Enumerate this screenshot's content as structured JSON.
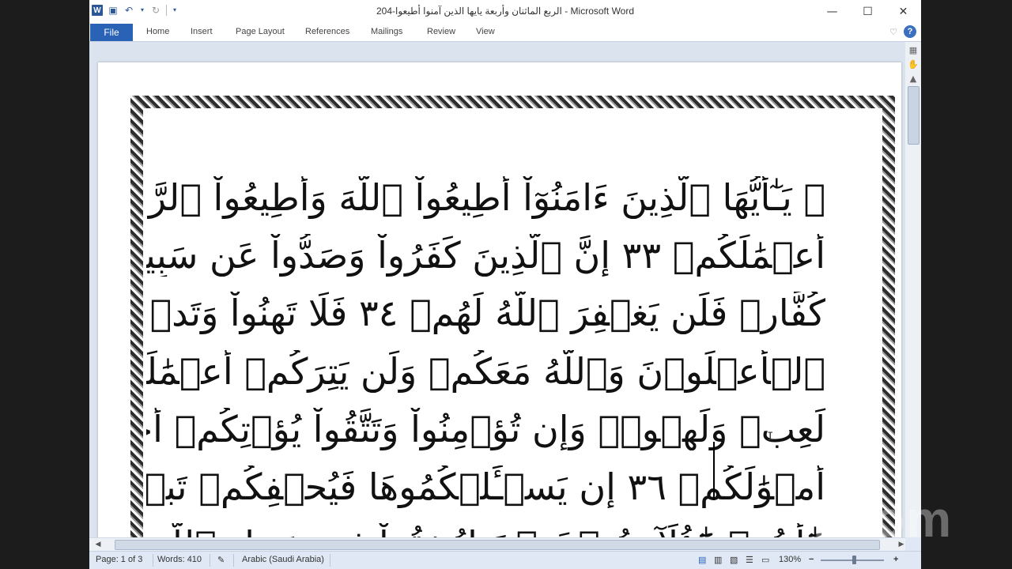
{
  "window": {
    "title": "الربع الماثنان وأربعة  يايها الذين آمنوا أطيعوا-204  -  Microsoft Word",
    "logo_letter": "W",
    "controls": {
      "minimize": "—",
      "maximize": "☐",
      "close": "✕"
    }
  },
  "ribbon": {
    "file_label": "File",
    "tabs": [
      "Home",
      "Insert",
      "Page Layout",
      "References",
      "Mailings",
      "Review",
      "View"
    ]
  },
  "document": {
    "lines": [
      "۞ يَـٰٓأَيُّهَا ٱلَّذِينَ ءَامَنُوٓاْ أَطِيعُواْ ٱللَّهَ وَأَطِيعُواْ ٱلرَّسُولَ وَلَا تُبۡطِلُوٓاْ",
      "أَعۡمَٰلَكُمۡ ٣٣ إِنَّ ٱلَّذِينَ كَفَرُواْ وَصَدُّواْ عَن سَبِيلِ ٱللَّهِ ثُمَّ مَاتُواْ وَهُمۡ",
      "كُفَّارٞ فَلَن يَغۡفِرَ ٱللَّهُ لَهُمۡ ٣٤ فَلَا تَهِنُواْ وَتَدۡعُوٓاْ إِلَى ٱلسَّلۡمِ وَأَنتُمُ",
      "ٱلۡأَعۡلَوۡنَ وَٱللَّهُ مَعَكُمۡ وَلَن يَتِرَكُمۡ أَعۡمَٰلَكُمۡ ٣٥ إِنَّمَا ٱلۡحَيَوٰةُ ٱلدُّنۡيَا",
      "لَعِبٞ وَلَهۡوٞۚ وَإِن تُؤۡمِنُواْ وَتَتَّقُواْ يُؤۡتِكُمۡ أُجُورَكُمۡ وَلَا يَسۡـَٔلۡكُمۡ",
      "أَمۡوَٰلَكُمۡ ٣٦ إِن يَسۡـَٔلۡكُمُوهَا فَيُحۡفِكُمۡ تَبۡخَلُواْ وَيُخۡرِجۡ أَضۡغَٰنَكُمۡ",
      "هَٰٓأَنتُمۡ هَٰٓؤُلَآءِ تُدۡعَوۡنَ لِتُنفِقُواْ فِي سَبِيلِ ٱللَّهِ فَمِنكُم مَّن يَبۡخَلُ"
    ]
  },
  "status_bar": {
    "page": "Page: 1 of 3",
    "words": "Words: 410",
    "language": "Arabic (Saudi Arabia)",
    "zoom": "130%",
    "zoom_minus": "−",
    "zoom_plus": "+"
  },
  "watermark": "zoom",
  "colors": {
    "ribbon_file_tab": "#2a62b6",
    "text_red": "#d00000",
    "frame": "#2d2d2d"
  }
}
